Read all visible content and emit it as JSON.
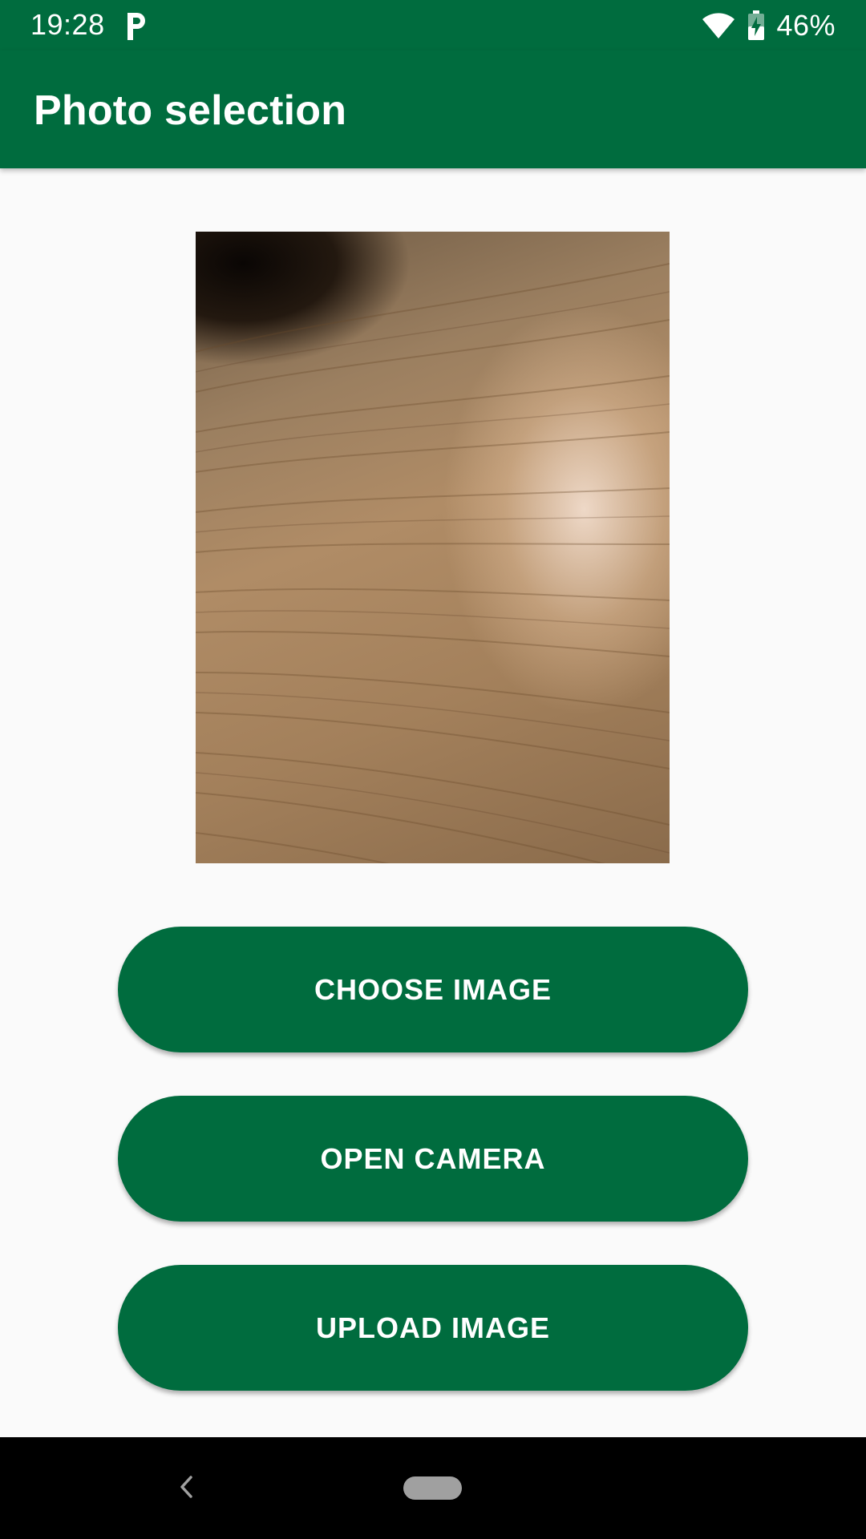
{
  "status_bar": {
    "time": "19:28",
    "notification_icon": "parking-p-icon",
    "wifi_icon": "wifi-icon",
    "battery_icon": "battery-charging-icon",
    "battery_percent": "46%"
  },
  "app_bar": {
    "title": "Photo selection"
  },
  "main": {
    "photo": {
      "description_icon": "selected-photo"
    },
    "buttons": {
      "choose_image": "CHOOSE IMAGE",
      "open_camera": "OPEN CAMERA",
      "upload_image": "UPLOAD IMAGE"
    }
  },
  "nav_bar": {
    "back_icon": "back-chevron-icon",
    "home_icon": "home-pill-icon"
  },
  "colors": {
    "primary": "#006c3e",
    "background": "#fafafa",
    "nav_bar": "#000000"
  }
}
